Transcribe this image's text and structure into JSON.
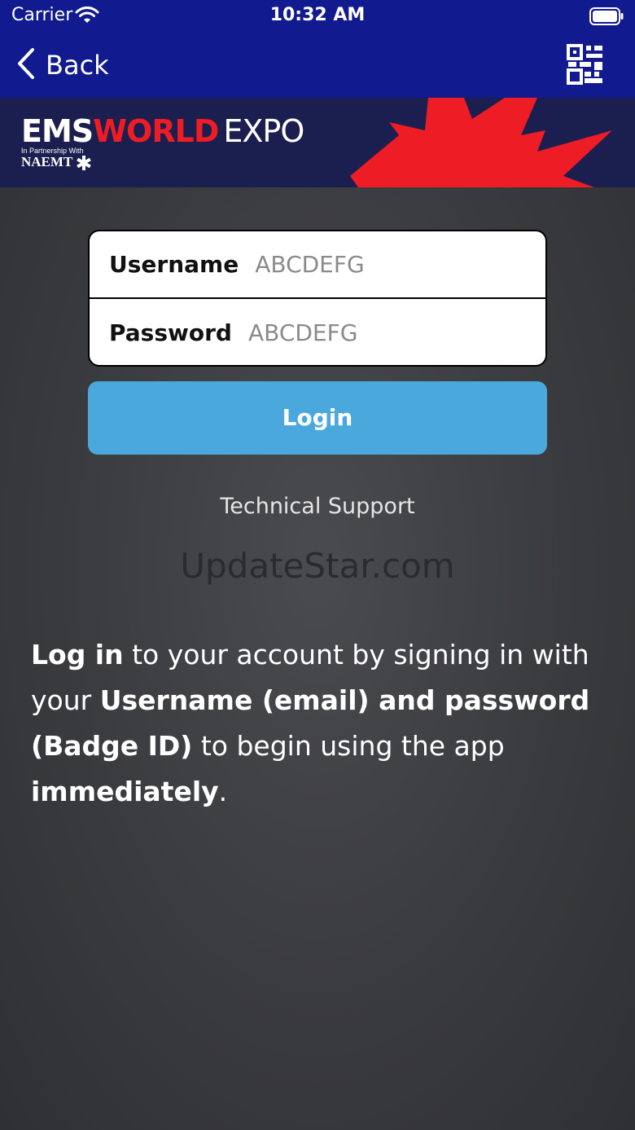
{
  "status_bar": {
    "carrier": "Carrier",
    "time": "10:32 AM"
  },
  "nav": {
    "back_label": "Back",
    "right_icon": "qr-code-icon"
  },
  "banner": {
    "logo_ems": "EMS",
    "logo_world": "WORLD",
    "logo_expo": "EXPO",
    "logo_subtitle": "In Partnership With",
    "logo_naemt": "NAEMT"
  },
  "form": {
    "username_label": "Username",
    "username_placeholder": "ABCDEFG",
    "password_label": "Password",
    "password_placeholder": "ABCDEFG",
    "login_label": "Login"
  },
  "support_link": "Technical Support",
  "watermark": "UpdateStar.com",
  "description": {
    "p1_bold": "Log in",
    "p2": " to your account by signing in with your ",
    "p3_bold": "Username (email) and password (Badge ID)",
    "p4": " to begin using the app ",
    "p5_bold": "immediately",
    "p6": "."
  },
  "colors": {
    "nav_bg": "#111a8e",
    "banner_bg": "#1b1f4f",
    "accent_red": "#ee1c25",
    "login_button": "#4aa8dc",
    "background": "#3b3c3f"
  }
}
